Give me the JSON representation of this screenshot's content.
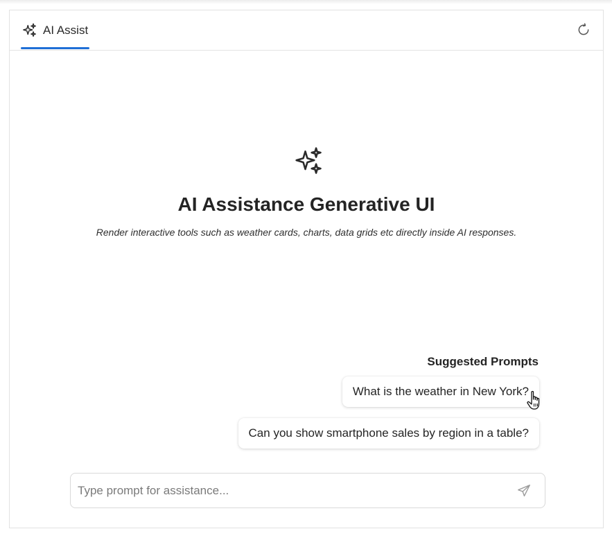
{
  "tab": {
    "label": "AI Assist",
    "icon": "sparkles-icon",
    "accent_color": "#1f6fd6"
  },
  "header": {
    "refresh_icon": "refresh-icon"
  },
  "hero": {
    "icon": "sparkles-icon",
    "title": "AI Assistance Generative UI",
    "subtitle": "Render interactive tools such as weather cards, charts, data grids etc directly inside AI responses."
  },
  "suggestions": {
    "heading": "Suggested Prompts",
    "items": [
      "What is the weather in New York?",
      "Can you show smartphone sales by region in a table?"
    ]
  },
  "composer": {
    "placeholder": "Type prompt for assistance...",
    "value": "",
    "send_icon": "send-icon"
  }
}
